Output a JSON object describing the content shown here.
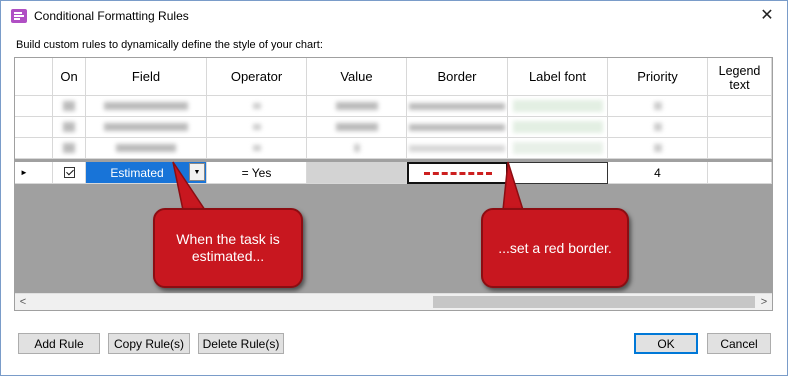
{
  "window": {
    "title": "Conditional Formatting Rules",
    "close_glyph": "✕"
  },
  "subtitle": "Build custom rules to dynamically define the style of your chart:",
  "grid": {
    "columns": [
      "On",
      "Field",
      "Operator",
      "Value",
      "Border",
      "Label font",
      "Priority",
      "Legend text"
    ],
    "active_row": {
      "on_checked": true,
      "field": "Estimated",
      "operator": "= Yes",
      "value": "",
      "border_color": "#cc1f1f",
      "border_style": "dashed",
      "label_font": "",
      "priority": "4",
      "legend_text": ""
    },
    "row_marker_glyph": "►"
  },
  "callouts": {
    "left": "When the task is estimated...",
    "right": "...set a red border.",
    "color": "#c8171f"
  },
  "scrollbar": {
    "left_glyph": "<",
    "right_glyph": ">"
  },
  "buttons": {
    "add_rule": "Add Rule",
    "copy_rules": "Copy Rule(s)",
    "delete_rules": "Delete Rule(s)",
    "ok": "OK",
    "cancel": "Cancel"
  }
}
